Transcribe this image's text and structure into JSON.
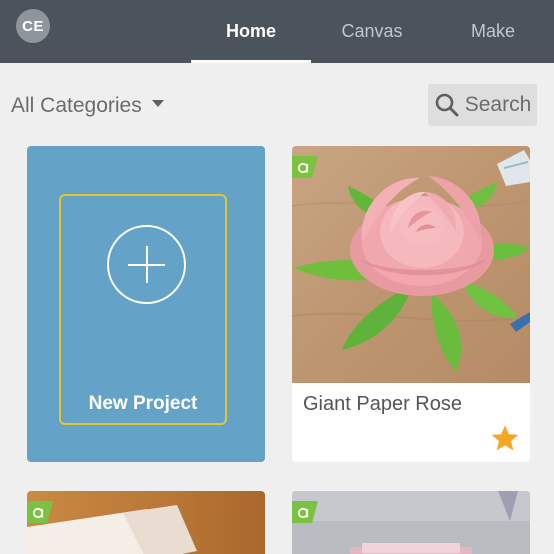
{
  "header": {
    "avatar_initials": "CE",
    "tabs": [
      {
        "label": "Home",
        "active": true
      },
      {
        "label": "Canvas",
        "active": false
      },
      {
        "label": "Make",
        "active": false
      }
    ]
  },
  "filter": {
    "category_label": "All Categories",
    "search_label": "Search"
  },
  "cards": {
    "new_project_label": "New Project",
    "projects": [
      {
        "title": "Giant Paper Rose",
        "favorited": true,
        "badge": "a"
      }
    ],
    "partial_badges": [
      "a",
      "a"
    ]
  },
  "colors": {
    "nav_bg": "#4b535c",
    "new_project_bg": "#64a2c8",
    "new_project_frame": "#e4c634",
    "access_badge": "#7cc242",
    "star": "#f5a623"
  }
}
